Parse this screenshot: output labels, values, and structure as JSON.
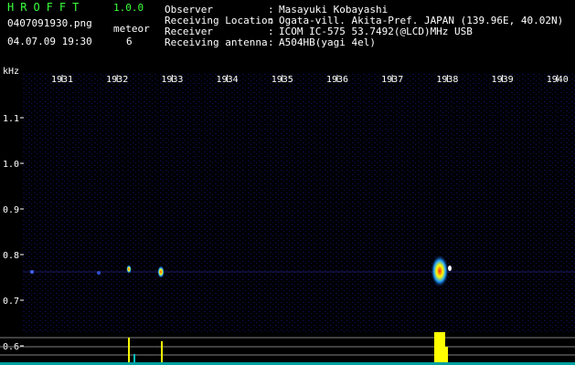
{
  "app": {
    "title": "HROFFT",
    "version": "1.0.0"
  },
  "file": {
    "name": "0407091930.png",
    "datetime": "04.07.09 19:30"
  },
  "meteor": {
    "label": "meteor",
    "count": "6"
  },
  "info": [
    {
      "key": "Observer",
      "value": "Masayuki Kobayashi"
    },
    {
      "key": "Receiving Location",
      "value": "Ogata-vill. Akita-Pref. JAPAN (139.96E, 40.02N)"
    },
    {
      "key": "Receiver",
      "value": "ICOM IC-575 53.7492(@LCD)MHz USB"
    },
    {
      "key": "Receiving antenna",
      "value": "A504HB(yagi 4el)"
    }
  ],
  "axis": {
    "unit": "kHz",
    "x_ticks": [
      "1931",
      "1932",
      "1933",
      "1934",
      "1935",
      "1936",
      "1937",
      "1938",
      "1939",
      "1940"
    ],
    "y_ticks": [
      "1.1",
      "1.0",
      "0.9",
      "0.8",
      "0.7",
      "0.6"
    ]
  },
  "colors": {
    "accent": "#3cff3c",
    "background": "#000000",
    "spectrogram": "#0a0a3a"
  }
}
